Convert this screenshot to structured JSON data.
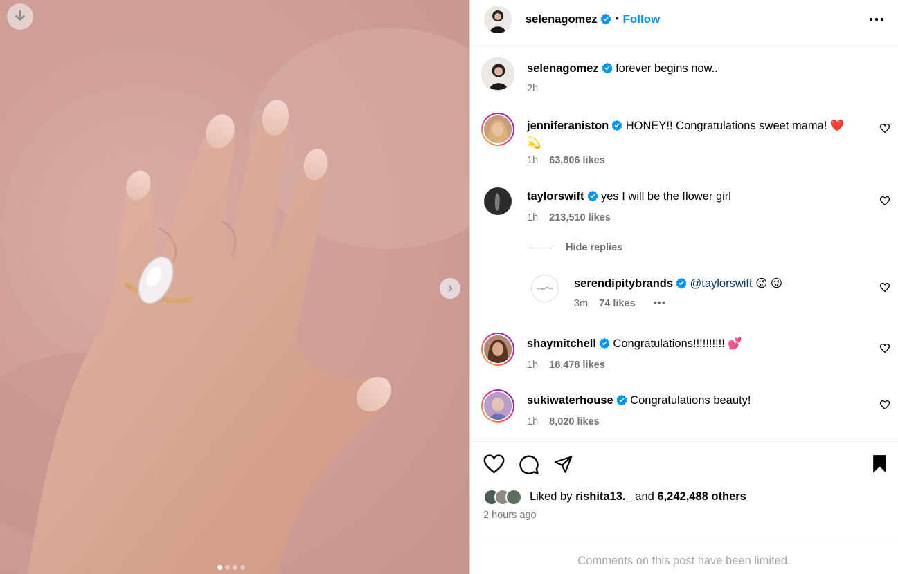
{
  "post": {
    "author": "selenagomez",
    "follow_label": "Follow",
    "caption": "forever begins now..",
    "caption_time": "2h",
    "liked_by_prefix": "Liked by",
    "liked_by_user": "rishita13._",
    "liked_by_and": "and",
    "liked_by_others": "6,242,488 others",
    "posted_ago": "2 hours ago",
    "comments_limited": "Comments on this post have been limited.",
    "carousel_count": 4,
    "carousel_active": 0
  },
  "comments": [
    {
      "user": "jenniferaniston",
      "text": "HONEY!! Congratulations sweet mama!",
      "emoji": "❤️",
      "emoji2": "💫",
      "time": "1h",
      "likes": "63,806 likes"
    },
    {
      "user": "taylorswift",
      "text": "yes I will be the flower girl",
      "time": "1h",
      "likes": "213,510 likes"
    },
    {
      "user": "shaymitchell",
      "text": "Congratulations!!!!!!!!!!",
      "emoji": "💕",
      "time": "1h",
      "likes": "18,478 likes"
    },
    {
      "user": "sukiwaterhouse",
      "text": "Congratulations beauty!",
      "time": "1h",
      "likes": "8,020 likes"
    }
  ],
  "hide_replies_label": "Hide replies",
  "reply": {
    "user": "serendipitybrands",
    "mention": "@taylorswift",
    "emoji": "😜 😜",
    "time": "3m",
    "likes": "74 likes",
    "more": "•••"
  },
  "colors": {
    "accent": "#0095f6",
    "verified": "#0095f6",
    "muted": "#737373"
  }
}
